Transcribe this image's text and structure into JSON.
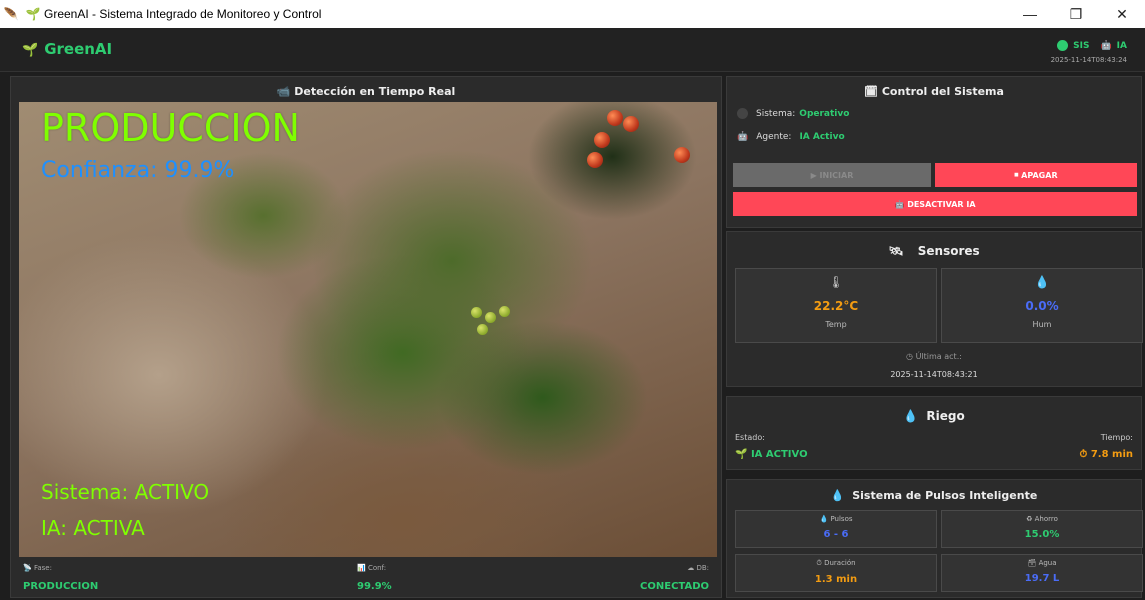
{
  "window": {
    "title": "GreenAI - Sistema Integrado de Monitoreo y Control",
    "icon": "seedling-icon"
  },
  "header": {
    "brand": "GreenAI",
    "status_sis": "SIS",
    "status_ia": "IA",
    "timestamp": "2025-11-14T08:43:24"
  },
  "camera": {
    "title": "Detección en Tiempo Real",
    "overlay_phase": "PRODUCCION",
    "overlay_confidence": "Confianza: 99.9%",
    "overlay_system": "Sistema: ACTIVO",
    "overlay_ia": "IA: ACTIVA",
    "stats": {
      "fase_label": "Fase:",
      "fase_value": "PRODUCCION",
      "conf_label": "Conf:",
      "conf_value": "99.9%",
      "db_label": "DB:",
      "db_value": "CONECTADO"
    }
  },
  "control": {
    "title": "Control del Sistema",
    "sistema_label": "Sistema:",
    "sistema_value": "Operativo",
    "agente_label": "Agente:",
    "agente_value": "IA Activo",
    "btn_iniciar": "INICIAR",
    "btn_apagar": "APAGAR",
    "btn_desactivar": "DESACTIVAR IA"
  },
  "sensores": {
    "title": "Sensores",
    "temp_value": "22.2°C",
    "temp_label": "Temp",
    "hum_value": "0.0%",
    "hum_label": "Hum",
    "last_label": "Última act.:",
    "last_value": "2025-11-14T08:43:21"
  },
  "riego": {
    "title": "Riego",
    "estado_label": "Estado:",
    "estado_value": "IA ACTIVO",
    "tiempo_label": "Tiempo:",
    "tiempo_value": "7.8 min"
  },
  "pulsos": {
    "title": "Sistema de Pulsos Inteligente",
    "pulsos_label": "Pulsos",
    "pulsos_value": "6 - 6",
    "ahorro_label": "Ahorro",
    "ahorro_value": "15.0%",
    "duracion_label": "Duración",
    "duracion_value": "1.3 min",
    "agua_label": "Agua",
    "agua_value": "19.7 L"
  },
  "colors": {
    "accent_green": "#2ecc71",
    "danger_red": "#ff4757",
    "temp_orange": "#f39c12",
    "hum_blue": "#4a6cf7",
    "overlay_lime": "#7fff00",
    "overlay_blue": "#1e90ff"
  }
}
